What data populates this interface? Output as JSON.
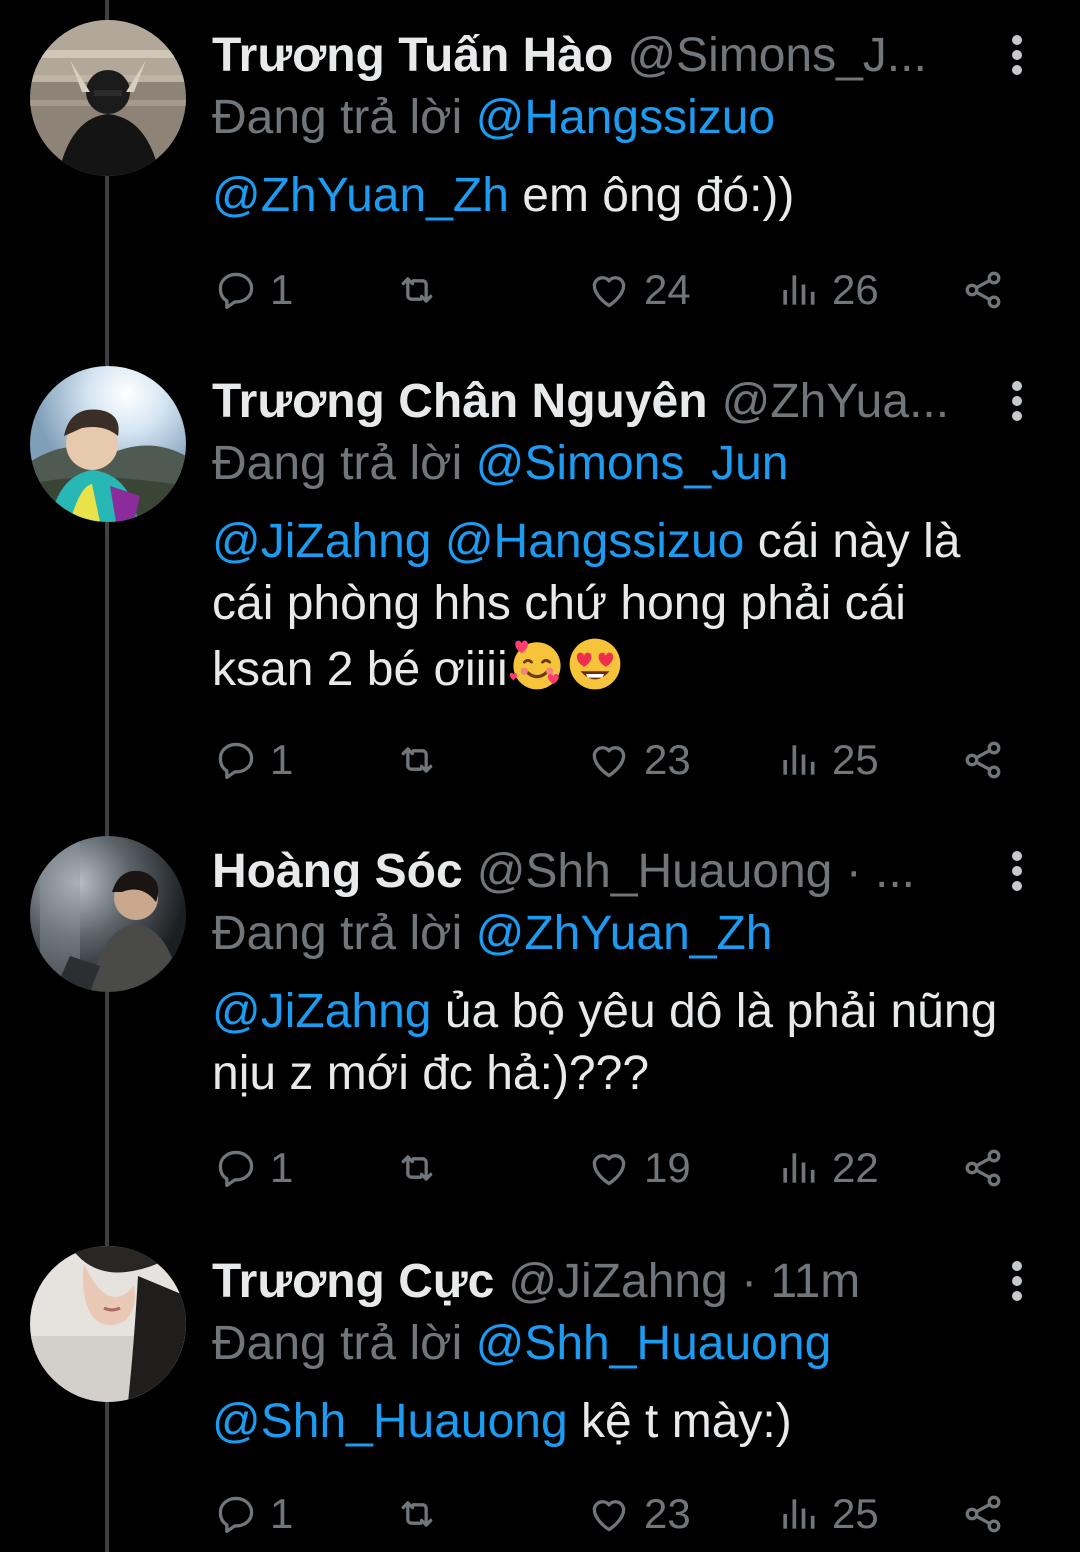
{
  "tweets": [
    {
      "name": "Trương Tuấn Hào",
      "handle": "@Simons_J...",
      "reply_prefix": "Đang trả lời",
      "reply_to": "@Hangssizuo",
      "body_mentions": "@ZhYuan_Zh",
      "body_text": " em ông đó:))",
      "stats": {
        "replies": "1",
        "likes": "24",
        "views": "26"
      }
    },
    {
      "name": "Trương Chân Nguyên",
      "handle": "@ZhYua...",
      "reply_prefix": "Đang trả lời",
      "reply_to": "@Simons_Jun",
      "body_mentions": "@JiZahng @Hangssizuo",
      "body_text": " cái này là cái phòng hhs chứ hong phải cái ksan 2 bé ơiiii",
      "body_emojis": [
        "smiling-face-with-hearts",
        "heart-eyes"
      ],
      "stats": {
        "replies": "1",
        "likes": "23",
        "views": "25"
      }
    },
    {
      "name": "Hoàng Sóc",
      "handle": "@Shh_Huauong · ...",
      "reply_prefix": "Đang trả lời",
      "reply_to": "@ZhYuan_Zh",
      "body_mentions": "@JiZahng",
      "body_text": " ủa bộ yêu dô là phải nũng nịu z mới đc hả:)???",
      "stats": {
        "replies": "1",
        "likes": "19",
        "views": "22"
      }
    },
    {
      "name": "Trương Cực",
      "handle": "@JiZahng · 11m",
      "reply_prefix": "Đang trả lời",
      "reply_to": "@Shh_Huauong",
      "body_mentions": "@Shh_Huauong",
      "body_text": " kệ t mày:)",
      "stats": {
        "replies": "1",
        "likes": "23",
        "views": "25"
      }
    }
  ],
  "colors": {
    "background": "#000000",
    "text_primary": "#e7e9ea",
    "text_secondary": "#71767b",
    "accent_link": "#1d9bf0",
    "thread_line": "#3e4144"
  },
  "icons": [
    "reply-icon",
    "retweet-icon",
    "like-icon",
    "views-icon",
    "share-icon",
    "more-icon"
  ]
}
